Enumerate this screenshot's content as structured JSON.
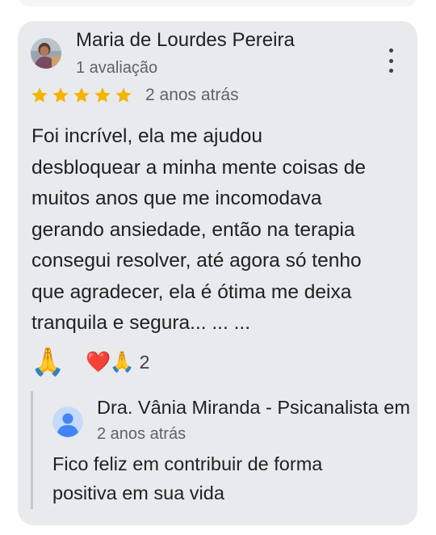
{
  "review": {
    "author_name": "Maria de Lourdes Pereira",
    "author_meta": "1 avaliação",
    "rating": 5,
    "rating_max": 5,
    "date": "2 anos atrás",
    "text": "Foi incrível, ela me ajudou\ndesbloquear a minha mente coisas de\nmuitos anos que me incomodava\ngerando ansiedade, então na terapia\nconsegui resolver, até agora só tenho\nque agradecer, ela é ótima me deixa\ntranquila e segura... ... ...",
    "reaction_primary": "🙏",
    "reaction_secondary": "❤️🙏",
    "reaction_count": "2"
  },
  "reply": {
    "author_name": "Dra. Vânia Miranda - Psicanalista em",
    "date": "2 anos atrás",
    "text": "Fico feliz em contribuir de forma\npositiva em sua vida"
  },
  "icons": {
    "menu": "more-vert-icon",
    "star": "star-icon",
    "reviewer_avatar": "user-photo-avatar",
    "owner_avatar": "default-person-avatar"
  },
  "colors": {
    "card_background": "#e8eaed",
    "star": "#f4b400",
    "owner_avatar_bg": "#c6dafc",
    "owner_avatar_fg": "#4285f4"
  }
}
